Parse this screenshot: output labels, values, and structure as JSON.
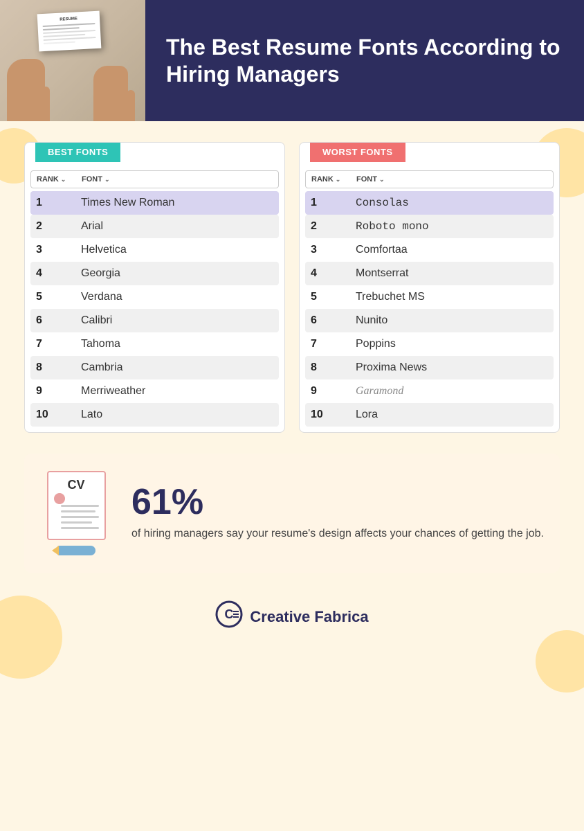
{
  "header": {
    "title": "The Best Resume Fonts According to Hiring Managers"
  },
  "best_fonts": {
    "badge": "BEST FONTS",
    "col_rank": "RANK",
    "col_font": "FONT",
    "items": [
      {
        "rank": "1",
        "font": "Times New Roman",
        "highlight": true
      },
      {
        "rank": "2",
        "font": "Arial",
        "highlight": false
      },
      {
        "rank": "3",
        "font": "Helvetica",
        "highlight": false
      },
      {
        "rank": "4",
        "font": "Georgia",
        "highlight": false
      },
      {
        "rank": "5",
        "font": "Verdana",
        "highlight": false
      },
      {
        "rank": "6",
        "font": "Calibri",
        "highlight": false
      },
      {
        "rank": "7",
        "font": "Tahoma",
        "highlight": false
      },
      {
        "rank": "8",
        "font": "Cambria",
        "highlight": false
      },
      {
        "rank": "9",
        "font": "Merriweather",
        "highlight": false
      },
      {
        "rank": "10",
        "font": "Lato",
        "highlight": false
      }
    ]
  },
  "worst_fonts": {
    "badge": "WORST FONTS",
    "col_rank": "RANK",
    "col_font": "FONT",
    "items": [
      {
        "rank": "1",
        "font": "Consolas",
        "highlight": true,
        "mono": true
      },
      {
        "rank": "2",
        "font": "Roboto mono",
        "highlight": false,
        "mono": true
      },
      {
        "rank": "3",
        "font": "Comfortaa",
        "highlight": false
      },
      {
        "rank": "4",
        "font": "Montserrat",
        "highlight": false
      },
      {
        "rank": "5",
        "font": "Trebuchet MS",
        "highlight": false
      },
      {
        "rank": "6",
        "font": "Nunito",
        "highlight": false
      },
      {
        "rank": "7",
        "font": "Poppins",
        "highlight": false
      },
      {
        "rank": "8",
        "font": "Proxima News",
        "highlight": false
      },
      {
        "rank": "9",
        "font": "Garamond",
        "highlight": false,
        "faded": true
      },
      {
        "rank": "10",
        "font": "Lora",
        "highlight": false
      }
    ]
  },
  "stat": {
    "percent": "61%",
    "description": "of hiring managers say your resume's design affects your chances of getting the job."
  },
  "footer": {
    "brand": "Creative Fabrica"
  }
}
